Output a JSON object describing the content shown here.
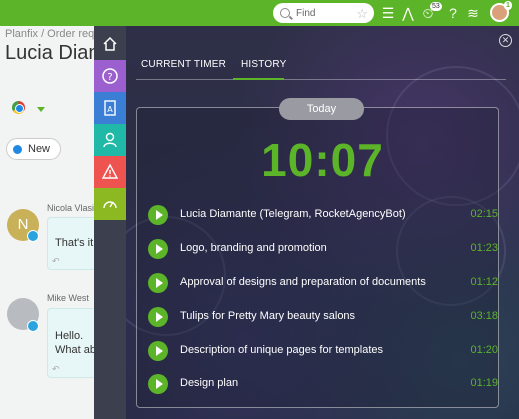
{
  "topbar": {
    "search_placeholder": "Find",
    "notification_count": "53",
    "alert_count": "1"
  },
  "task": {
    "breadcrumb": "Planfix / Order requ",
    "title": "Lucia Diama",
    "status": "New"
  },
  "comments": [
    {
      "author": "Nicola Vlasi",
      "initial": "N",
      "text": "That's it,"
    },
    {
      "author": "Mike West",
      "initial": "",
      "text_line1": "Hello.",
      "text_line2": "What ab"
    }
  ],
  "sidebar": {
    "items": [
      "home-icon",
      "help-icon",
      "contacts-icon",
      "user-icon",
      "warning-icon",
      "speedometer-icon"
    ]
  },
  "timer": {
    "tabs": [
      {
        "label": "CURRENT TIMER",
        "active": false
      },
      {
        "label": "HISTORY",
        "active": true
      }
    ],
    "day_label": "Today",
    "total": "10:07",
    "entries": [
      {
        "title": "Lucia Diamante (Telegram, RocketAgencyBot)",
        "duration": "02:15"
      },
      {
        "title": "Logo, branding and promotion",
        "duration": "01:23"
      },
      {
        "title": "Approval of designs and preparation of documents",
        "duration": "01:12"
      },
      {
        "title": "Tulips for Pretty Mary beauty salons",
        "duration": "03:18"
      },
      {
        "title": "Description of unique pages for templates",
        "duration": "01:20"
      },
      {
        "title": "Design plan",
        "duration": "01:19"
      }
    ]
  },
  "colors": {
    "accent": "#5cb428",
    "panel_bg": "#2c2e47",
    "sidebar_bg": "#3c3f4e",
    "help": "#9b5fcf",
    "contacts": "#3a7fd5",
    "user": "#20b8a6",
    "warning": "#ef5350",
    "speed": "#8cb822"
  }
}
